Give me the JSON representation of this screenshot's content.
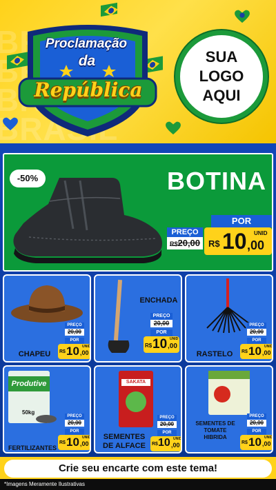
{
  "header": {
    "background_text": [
      "BRASIL",
      "BRASIL",
      "BRASIL",
      "BRASIL"
    ],
    "title_line1": "Proclamação",
    "title_line2": "da",
    "title_line3": "República",
    "logo_lines": [
      "SUA",
      "LOGO",
      "AQUI"
    ]
  },
  "featured": {
    "title": "BOTINA",
    "discount": "-50%",
    "price_label": "PREÇO",
    "price_old_currency": "R$",
    "price_old": "20,00",
    "por_label": "POR",
    "price_currency": "R$",
    "price_int": "10",
    "price_dec": ",00",
    "unit": "UNID"
  },
  "products": [
    {
      "name": "CHAPEU",
      "preco_label": "PREÇO",
      "old": "20,00",
      "por_label": "POR",
      "currency": "R$",
      "int": "10",
      "dec": ",00",
      "unit": "UNID"
    },
    {
      "name": "ENCHADA",
      "preco_label": "PREÇO",
      "old": "20,00",
      "por_label": "POR",
      "currency": "R$",
      "int": "10",
      "dec": ",00",
      "unit": "UNID"
    },
    {
      "name": "RASTELO",
      "preco_label": "PREÇO",
      "old": "20,00",
      "por_label": "POR",
      "currency": "R$",
      "int": "10",
      "dec": ",00",
      "unit": "UNID"
    },
    {
      "name": "FERTILIZANTES",
      "preco_label": "PREÇO",
      "old": "20,00",
      "por_label": "POR",
      "currency": "R$",
      "int": "10",
      "dec": ",00",
      "unit": "UNID",
      "package_brand": "Produtive",
      "package_weight": "50kg"
    },
    {
      "name": "SEMENTES\nDE ALFACE",
      "preco_label": "PREÇO",
      "old": "20,00",
      "por_label": "POR",
      "currency": "R$",
      "int": "10",
      "dec": ",00",
      "unit": "UNID",
      "package_brand": "SAKATA"
    },
    {
      "name": "SEMENTES DE\nTOMATE\nHIBRIDA",
      "preco_label": "PREÇO",
      "old": "20,00",
      "por_label": "POR",
      "currency": "R$",
      "int": "10",
      "dec": ",00",
      "unit": "UNID"
    }
  ],
  "footer": {
    "cta": "Crie seu encarte com este tema!",
    "disclaimer": "*Imagens Meramente Ilustrativas"
  },
  "colors": {
    "yellow": "#ffd21a",
    "green": "#0b9a3a",
    "blue": "#1246b8",
    "price_blue": "#1a5fd6"
  }
}
